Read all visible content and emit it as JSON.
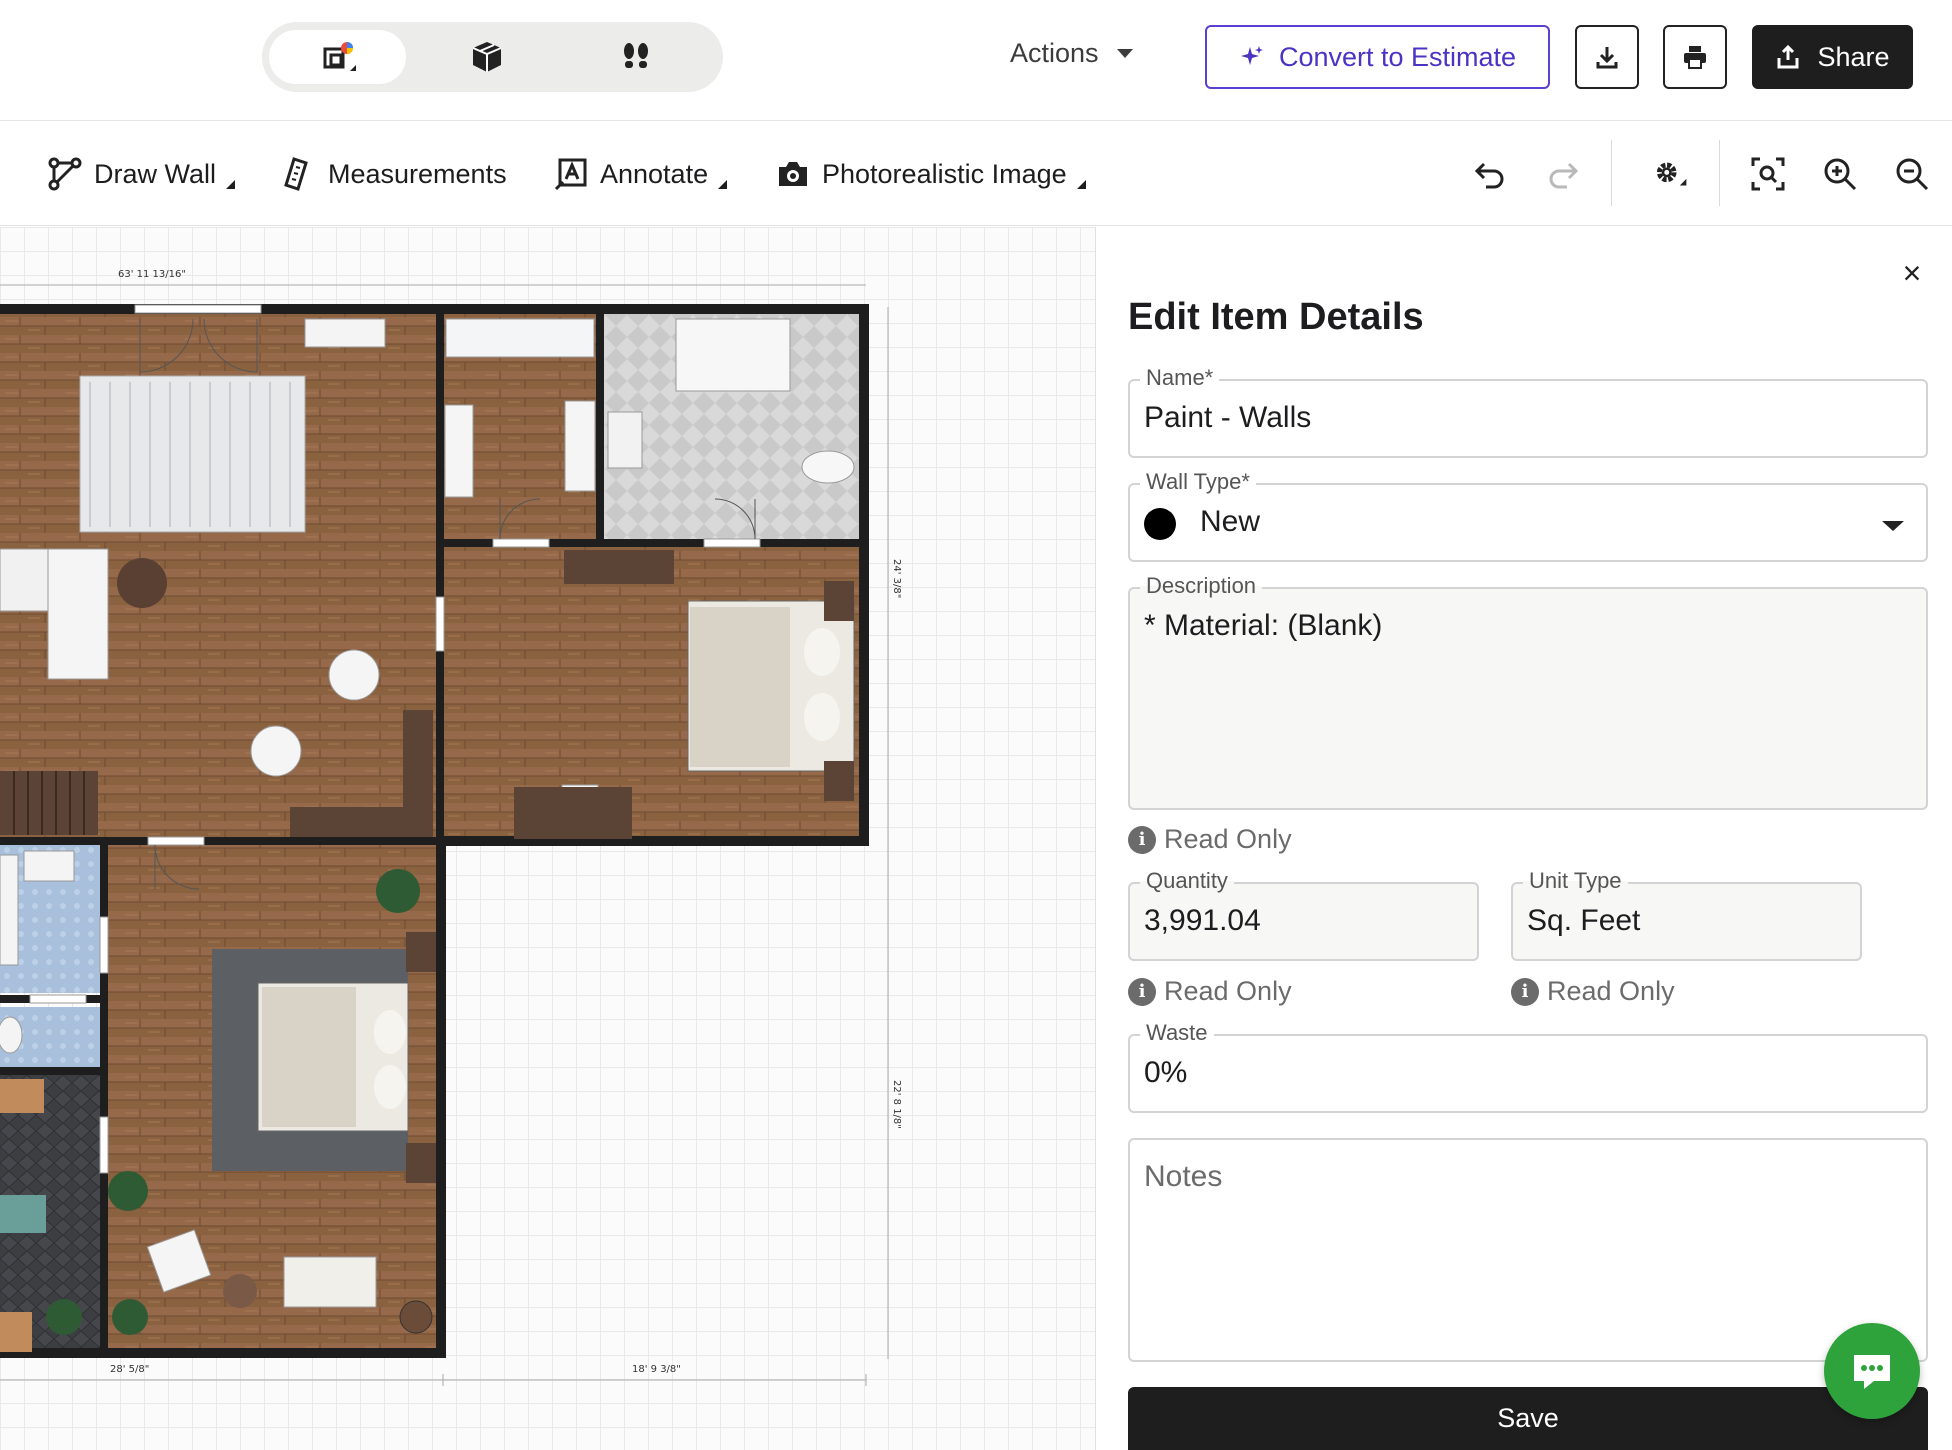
{
  "topbar": {
    "view_modes": [
      {
        "icon": "floor-plan-2d-icon",
        "active": true
      },
      {
        "icon": "cube-3d-icon",
        "active": false
      },
      {
        "icon": "footsteps-walkthrough-icon",
        "active": false
      }
    ],
    "actions_label": "Actions",
    "convert_label": "Convert to Estimate",
    "convert_icon": "sparkle-icon",
    "download_icon": "download-icon",
    "print_icon": "print-icon",
    "share_label": "Share",
    "share_icon": "share-icon",
    "accent_color": "#5b3fd1"
  },
  "toolbar": {
    "draw_wall_label": "Draw Wall",
    "measurements_label": "Measurements",
    "annotate_label": "Annotate",
    "photo_label": "Photorealistic Image",
    "icons": [
      "undo-icon",
      "redo-icon",
      "settings-icon",
      "zoom-fit-icon",
      "zoom-in-icon",
      "zoom-out-icon"
    ]
  },
  "canvas": {
    "dimensions": {
      "top": "63' 11 13/16\"",
      "right_upper": "24' 3/8\"",
      "right_lower": "22' 8 1/8\"",
      "bottom_left": "28' 5/8\"",
      "bottom_right": "18' 9 3/8\""
    }
  },
  "panel": {
    "title": "Edit Item Details",
    "close_icon": "close-icon",
    "name": {
      "label": "Name*",
      "value": "Paint - Walls"
    },
    "wall_type": {
      "label": "Wall Type*",
      "value": "New",
      "color": "#000000"
    },
    "description": {
      "label": "Description",
      "value": "* Material: (Blank)"
    },
    "read_only_text": "Read Only",
    "quantity": {
      "label": "Quantity",
      "value": "3,991.04"
    },
    "unit_type": {
      "label": "Unit Type",
      "value": "Sq. Feet"
    },
    "waste": {
      "label": "Waste",
      "value": "0%"
    },
    "notes": {
      "placeholder": "Notes"
    },
    "save_label": "Save",
    "chat_icon": "chat-bubble-icon",
    "chat_color": "#2ea33b"
  }
}
